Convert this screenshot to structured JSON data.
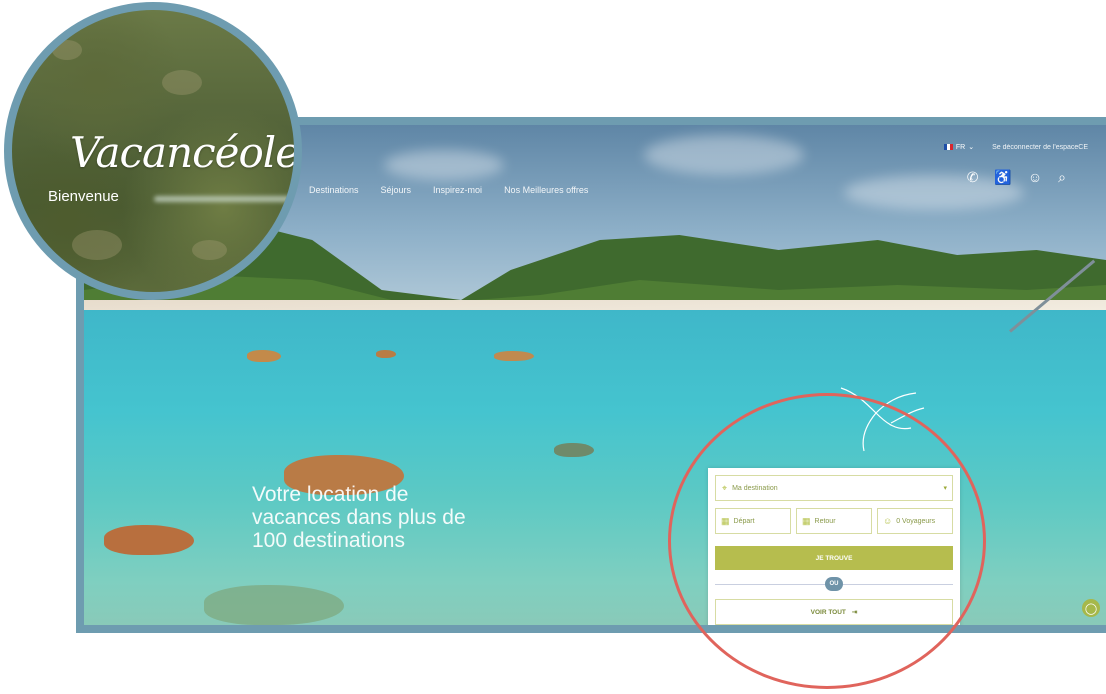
{
  "brand": {
    "logo_text": "Vacancéole",
    "welcome": "Bienvenue"
  },
  "header": {
    "language": "FR",
    "login_link": "Se déconnecter de l'espaceCE",
    "icons": [
      "phone-icon",
      "accessibility-icon",
      "user-icon",
      "search-icon"
    ]
  },
  "nav": {
    "items": [
      "Destinations",
      "Séjours",
      "Inspirez-moi",
      "Nos Meilleures offres"
    ]
  },
  "hero": {
    "headline": "Votre location de vacances dans plus de 100 destinations"
  },
  "search": {
    "destination_placeholder": "Ma destination",
    "departure": "Départ",
    "return": "Retour",
    "travelers": "0 Voyageurs",
    "find_button": "JE TROUVE",
    "or_label": "OU",
    "see_all_button": "VOIR TOUT"
  },
  "colors": {
    "frame_border": "#6e9cb0",
    "highlight_ring": "#e0645c",
    "accent_green": "#b6bd4e",
    "or_badge": "#6f93a8"
  }
}
